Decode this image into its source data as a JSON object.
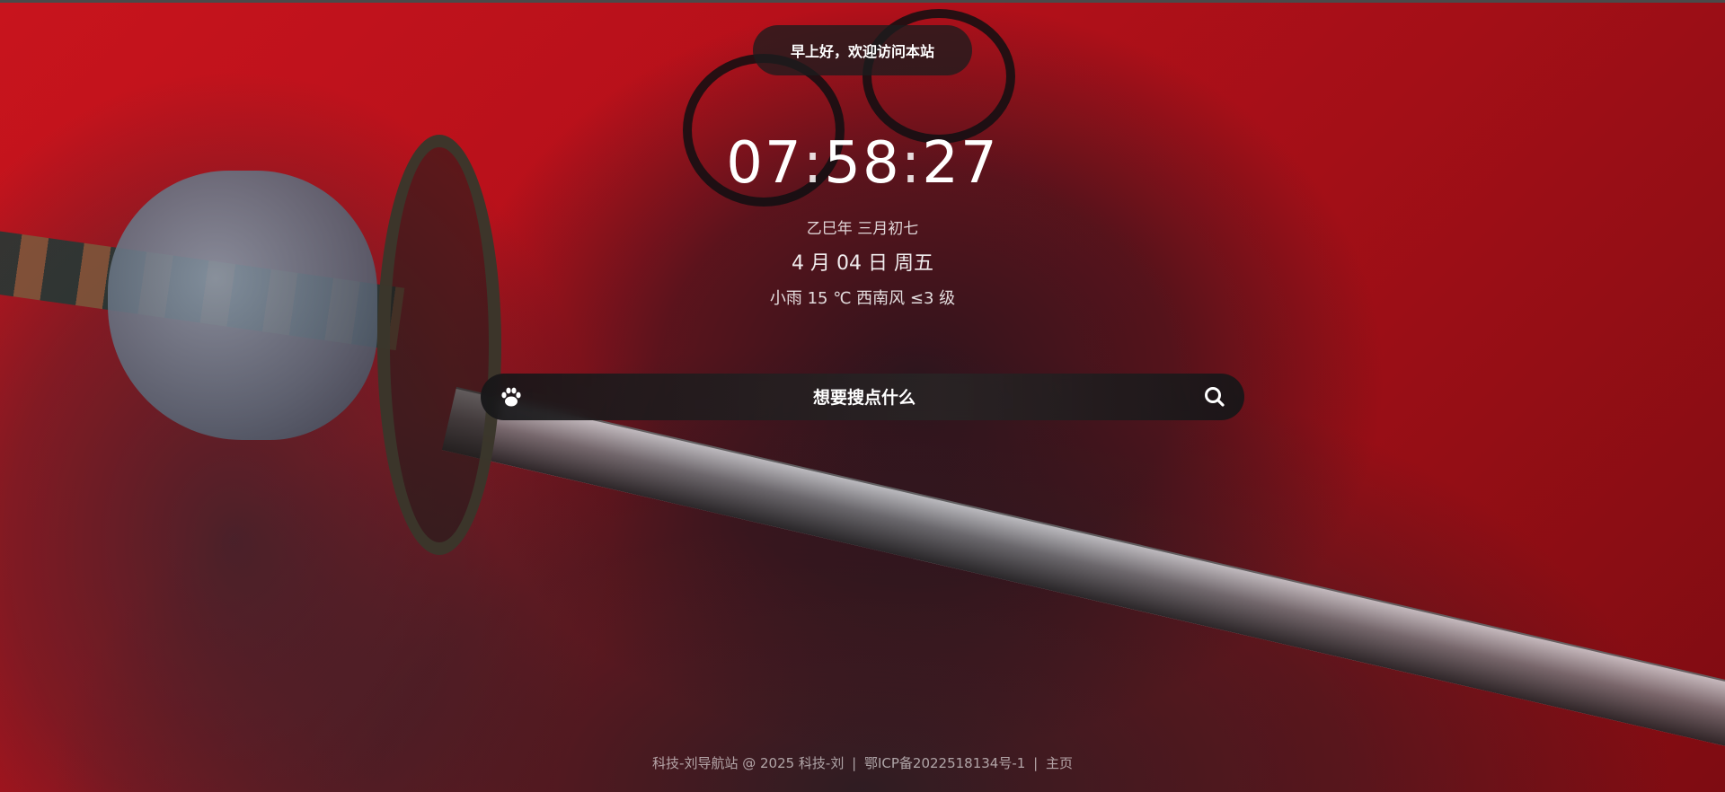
{
  "greeting": "早上好，欢迎访问本站",
  "clock": {
    "hours": "07",
    "minutes": "58",
    "seconds": "27"
  },
  "lunar_date": "乙巳年 三月初七",
  "date": "4 月 04 日 周五",
  "weather": "小雨 15 ℃ 西南风 ≤3 级",
  "search": {
    "placeholder": "想要搜点什么",
    "engine_icon": "paw-icon",
    "submit_icon": "search-icon"
  },
  "footer": {
    "copyright": "科技-刘导航站 @ 2025 科技-刘",
    "icp": "鄂ICP备2022518134号-1",
    "home": "主页"
  },
  "colors": {
    "background_red": "#c8141d",
    "panel_dark": "#1c1c1e",
    "text": "#ffffff"
  }
}
